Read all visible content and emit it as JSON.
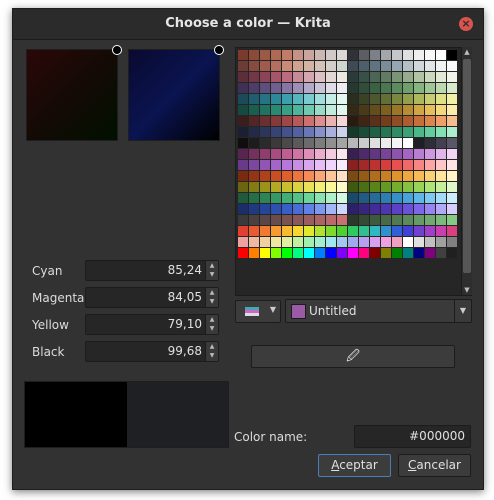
{
  "window": {
    "title": "Choose a color — Krita"
  },
  "squares": {
    "left_bg": "#0a0a0a",
    "right_bg": "#0a0a2a"
  },
  "cmyk": [
    {
      "label": "Cyan",
      "value": "85,24"
    },
    {
      "label": "Magenta",
      "value": "84,05"
    },
    {
      "label": "Yellow",
      "value": "79,10"
    },
    {
      "label": "Black",
      "value": "99,68"
    }
  ],
  "preview": {
    "current": "#000000",
    "previous": "#1f2023"
  },
  "palette": {
    "name": "Untitled",
    "swatch": "#9a5aa6",
    "colors": [
      "#7a3b2e",
      "#8c4a38",
      "#9c5a46",
      "#b06a54",
      "#c27b66",
      "#c69285",
      "#c9a69d",
      "#cbb8b2",
      "#d2cac7",
      "#dcd7d5",
      "#2f3237",
      "#5b5e63",
      "#7d8086",
      "#a3a6ab",
      "#c4c6c9",
      "#dedfe1",
      "#efefef",
      "#f8f8f8",
      "#fefefe",
      "#000000",
      "#6e3c36",
      "#884b40",
      "#a05b4d",
      "#b66f5f",
      "#c98a78",
      "#d2a291",
      "#d5b3a4",
      "#d4c2b8",
      "#d2cfc8",
      "#cfd6d0",
      "#3e4a55",
      "#4e5e6b",
      "#617381",
      "#7b8d99",
      "#97a7b1",
      "#b3c0c6",
      "#ced8dc",
      "#e0e6e7",
      "#f0f3f3",
      "#fafafa",
      "#5b2e3a",
      "#733848",
      "#8c4558",
      "#a6566b",
      "#bd6c7f",
      "#c98a98",
      "#d3a6b0",
      "#dcc0c4",
      "#e3d7d6",
      "#ece8e2",
      "#2a3b3a",
      "#385047",
      "#4b6654",
      "#607d63",
      "#7a9576",
      "#95ab8c",
      "#b1c3a4",
      "#cbd8bd",
      "#e1e9d5",
      "#f0f4e8",
      "#3e3155",
      "#4d3e69",
      "#5e4e7e",
      "#715f92",
      "#8675a5",
      "#9d8fb7",
      "#b4a9c8",
      "#cbc4d8",
      "#e0dce7",
      "#eeebf2",
      "#253a2e",
      "#2f4d38",
      "#3b6143",
      "#4a7650",
      "#5b8b5e",
      "#6ea06d",
      "#86b47f",
      "#a0c696",
      "#bcd8b0",
      "#d8e9cc",
      "#1c4a5a",
      "#1f5e70",
      "#257385",
      "#2c899a",
      "#3aa0ad",
      "#56b6bf",
      "#7acbcf",
      "#a1dddc",
      "#c6ece8",
      "#e2f6f2",
      "#2a2e1f",
      "#3a4226",
      "#4d582e",
      "#626f37",
      "#7a8741",
      "#949f4d",
      "#aeb75c",
      "#c8cd6f",
      "#dfe186",
      "#f1f0a4",
      "#144a40",
      "#1a5e50",
      "#217361",
      "#2a8973",
      "#389f86",
      "#4fb59a",
      "#6fc9b0",
      "#98dcc7",
      "#c1ecdd",
      "#e1f6ef",
      "#332914",
      "#4a3a17",
      "#634d1a",
      "#7e611f",
      "#9b7626",
      "#b78d31",
      "#d1a542",
      "#e6bf5a",
      "#f4d87c",
      "#fbecab",
      "#3a1e1e",
      "#522626",
      "#6b2f2f",
      "#853939",
      "#9f4646",
      "#b85858",
      "#cd7070",
      "#de8e8e",
      "#ebb2b2",
      "#f5d7d7",
      "#2a1a10",
      "#412514",
      "#5a3118",
      "#743e1d",
      "#904c24",
      "#ac5c2e",
      "#c66e3c",
      "#dc844f",
      "#ed9e69",
      "#f8bd8e",
      "#1a1f33",
      "#222a47",
      "#2c365d",
      "#374374",
      "#44518b",
      "#5461a1",
      "#6a76b6",
      "#8690c9",
      "#a8b0db",
      "#ccd1ec",
      "#153a2c",
      "#1a4d39",
      "#1f6146",
      "#267654",
      "#2f8c64",
      "#3aa275",
      "#4ab887",
      "#62cd9c",
      "#82e0b3",
      "#aaeecd",
      "#0e0e0e",
      "#1c1c1c",
      "#2b2b2b",
      "#3a3a3a",
      "#4a4a4a",
      "#5a5a5a",
      "#6b6b6b",
      "#7d7d7d",
      "#909090",
      "#a4a4a4",
      "#b8b8b8",
      "#cccccc",
      "#dfdfdf",
      "#ececec",
      "#f5f5f5",
      "#ffffff",
      "#1e1e24",
      "#2e2e38",
      "#41414f",
      "#575768",
      "#5a2450",
      "#74305f",
      "#8e3d6f",
      "#a84b80",
      "#c05d92",
      "#d273a5",
      "#e08fb9",
      "#eaadcc",
      "#f2cbe0",
      "#f9e6ef",
      "#3a1f52",
      "#4e2a6a",
      "#633682",
      "#794399",
      "#8f52ae",
      "#a665c2",
      "#bb7cd3",
      "#cf97e1",
      "#e1b5ec",
      "#f0d5f5",
      "#6a3a8a",
      "#7d47a0",
      "#9155b5",
      "#a465c8",
      "#b678d8",
      "#c78ee4",
      "#d7a6ee",
      "#e4bef5",
      "#efd5fa",
      "#f8ebfd",
      "#8a2020",
      "#a42828",
      "#be3232",
      "#d63d3d",
      "#e85050",
      "#f26868",
      "#f88585",
      "#fca5a5",
      "#fec7c7",
      "#ffe5e5",
      "#7a2a10",
      "#953514",
      "#b0411a",
      "#c94e22",
      "#de5e2d",
      "#ed733f",
      "#f68b57",
      "#fba676",
      "#fec49c",
      "#ffe0c7",
      "#7a4a10",
      "#955b14",
      "#b06d1a",
      "#c98022",
      "#de942d",
      "#eda83f",
      "#f6bd57",
      "#fbd176",
      "#fee49c",
      "#fff3c7",
      "#6b6410",
      "#837b14",
      "#9b921a",
      "#b3a922",
      "#c9bf2d",
      "#dbd23f",
      "#e9e257",
      "#f3ee76",
      "#f9f69c",
      "#fdfcc7",
      "#3e5a10",
      "#4b6f14",
      "#58841a",
      "#669922",
      "#75ae2d",
      "#86c23f",
      "#99d457",
      "#aee376",
      "#c6ef9c",
      "#e0f8c7",
      "#1f5a3a",
      "#256f47",
      "#2d8455",
      "#369963",
      "#42ae73",
      "#53c285",
      "#6bd499",
      "#8ae3b0",
      "#aeefc9",
      "#d4f8e3",
      "#1a4a6a",
      "#1f5b82",
      "#256c9a",
      "#2d7eb2",
      "#3890c8",
      "#48a3da",
      "#5fb6e8",
      "#7dc9f2",
      "#a3dbf8",
      "#cdedfc",
      "#1a2f6a",
      "#1f3a82",
      "#25459a",
      "#2d51b2",
      "#385ec8",
      "#486dda",
      "#5f81e8",
      "#7d98f2",
      "#a3b6f8",
      "#cdd7fc",
      "#2d1f6a",
      "#382582",
      "#432c9a",
      "#4f35b2",
      "#5c40c8",
      "#6b50da",
      "#7e66e8",
      "#9784f2",
      "#b4a8f8",
      "#d6cdfc",
      "#3a3a3a",
      "#4a4040",
      "#5a4646",
      "#6a4c4c",
      "#7a5252",
      "#8a5858",
      "#9a5e5e",
      "#aa6464",
      "#ba6a6a",
      "#ca7070",
      "#2a3a2a",
      "#344a34",
      "#3e5a3e",
      "#486a48",
      "#527a52",
      "#5c8a5c",
      "#669a66",
      "#70aa70",
      "#7aba7a",
      "#84ca84",
      "#e04030",
      "#e85a30",
      "#f07a30",
      "#f89a30",
      "#f8ba30",
      "#f8d830",
      "#e0e830",
      "#b0e030",
      "#80d830",
      "#50d030",
      "#30c860",
      "#30c090",
      "#30b8c0",
      "#3090d0",
      "#3060d8",
      "#4040d8",
      "#7040d0",
      "#a040c8",
      "#c840b0",
      "#d84080",
      "#f0a0a0",
      "#f0b8a0",
      "#f0d0a0",
      "#f0e8a0",
      "#e0f0a0",
      "#c0f0a0",
      "#a0f0b0",
      "#a0f0d0",
      "#a0e8f0",
      "#a0c8f0",
      "#a0a8f0",
      "#b8a0f0",
      "#d8a0f0",
      "#f0a0e0",
      "#f0a0c0",
      "#ffffff",
      "#e0e0e0",
      "#c0c0c0",
      "#a0a0a0",
      "#808080",
      "#ff0000",
      "#ff8000",
      "#ffff00",
      "#80ff00",
      "#00ff00",
      "#00ff80",
      "#00ffff",
      "#0080ff",
      "#0000ff",
      "#8000ff",
      "#ff00ff",
      "#ff0080",
      "#800000",
      "#808000",
      "#008000",
      "#008080",
      "#000080",
      "#800080",
      "#404040",
      "#202020"
    ]
  },
  "picker": {
    "icon": "eyedropper-icon",
    "glyph": "🖉"
  },
  "color_name": {
    "label": "Color name:",
    "value": "#000000"
  },
  "buttons": {
    "ok_first": "A",
    "ok_rest": "ceptar",
    "cancel_first": "C",
    "cancel_rest": "ancelar"
  }
}
